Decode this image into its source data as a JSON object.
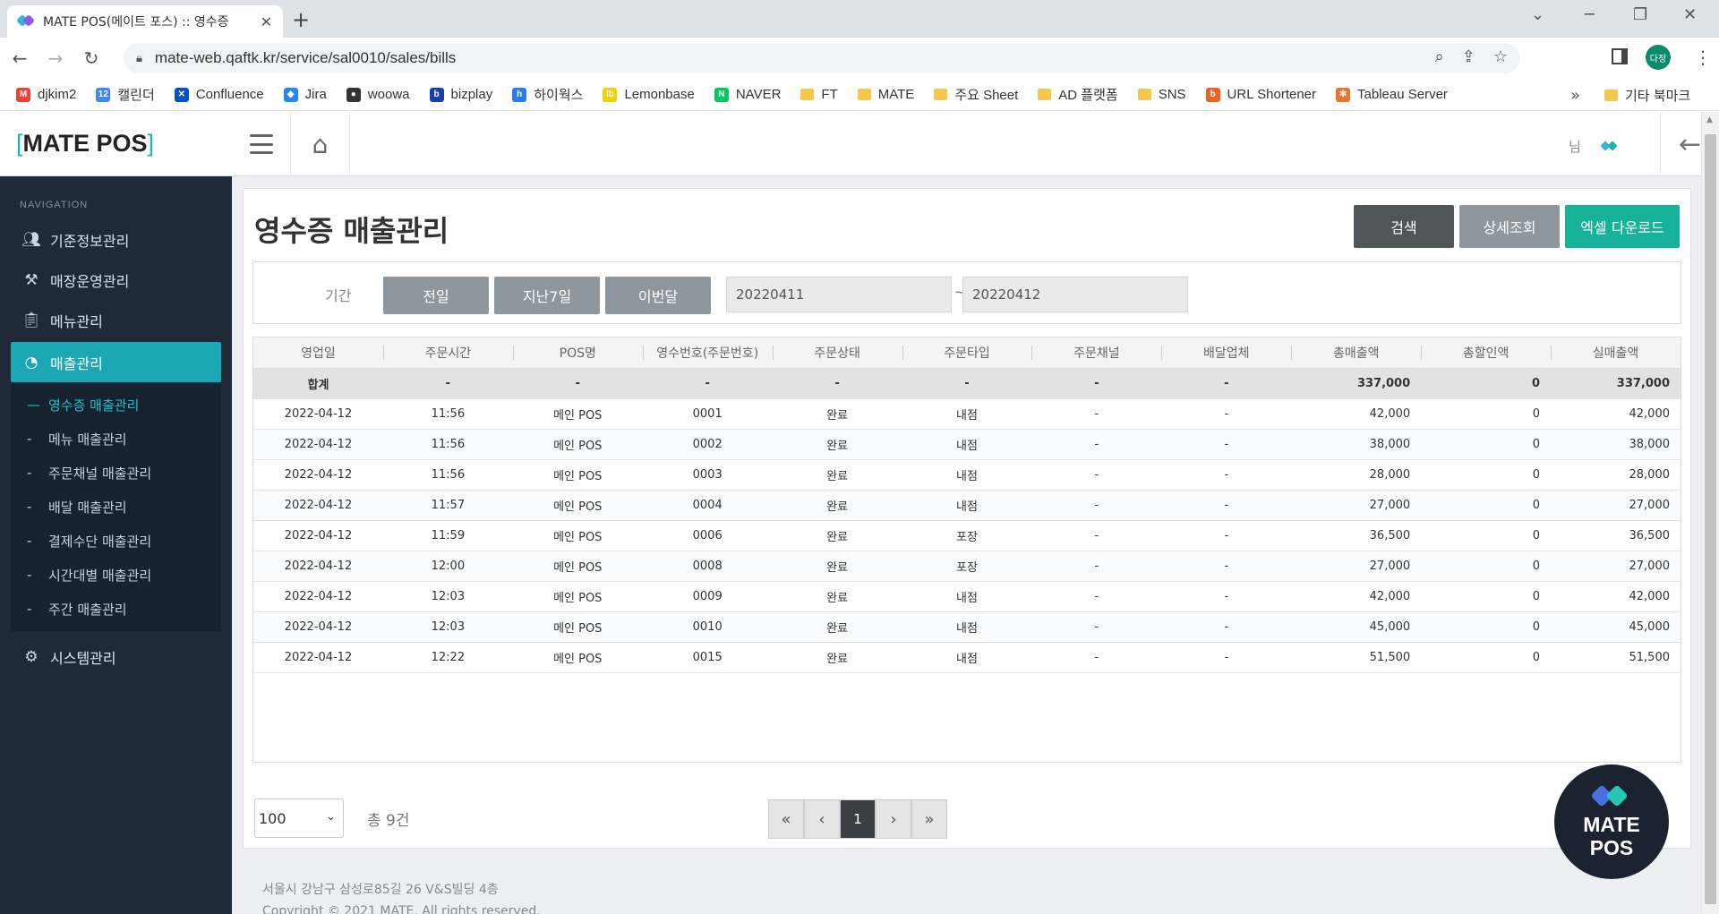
{
  "browser": {
    "tab_title": "MATE POS(메이트 포스) :: 영수증",
    "url": "mate-web.qaftk.kr/service/sal0010/sales/bills",
    "profile_initials": "다정",
    "bookmarks": [
      {
        "label": "djkim2",
        "color": "#ea4335",
        "glyph": "M"
      },
      {
        "label": "캘린더",
        "color": "#4285f4",
        "glyph": "12"
      },
      {
        "label": "Confluence",
        "color": "#0052cc",
        "glyph": "✕"
      },
      {
        "label": "Jira",
        "color": "#2684ff",
        "glyph": "◆"
      },
      {
        "label": "woowa",
        "color": "#333333",
        "glyph": "●"
      },
      {
        "label": "bizplay",
        "color": "#1a3fa8",
        "glyph": "b"
      },
      {
        "label": "하이웍스",
        "color": "#2b7de9",
        "glyph": "h"
      },
      {
        "label": "Lemonbase",
        "color": "#f5d000",
        "glyph": "lb"
      },
      {
        "label": "NAVER",
        "color": "#03c75a",
        "glyph": "N"
      },
      {
        "label": "FT",
        "color": "folder",
        "glyph": ""
      },
      {
        "label": "MATE",
        "color": "folder",
        "glyph": ""
      },
      {
        "label": "주요 Sheet",
        "color": "folder",
        "glyph": ""
      },
      {
        "label": "AD 플랫폼",
        "color": "folder",
        "glyph": ""
      },
      {
        "label": "SNS",
        "color": "folder",
        "glyph": ""
      },
      {
        "label": "URL Shortener",
        "color": "#ee6123",
        "glyph": "b"
      },
      {
        "label": "Tableau Server",
        "color": "#e8762d",
        "glyph": "✻"
      }
    ],
    "bookmark_more": "»",
    "other_bookmarks": "기타 북마크"
  },
  "app": {
    "brand_open": "[",
    "brand_name": "MATE POS",
    "brand_close": "]",
    "nav_caption": "NAVIGATION",
    "nav": [
      {
        "label": "기준정보관리",
        "icon": "users-icon"
      },
      {
        "label": "매장운영관리",
        "icon": "tools-icon"
      },
      {
        "label": "메뉴관리",
        "icon": "clipboard-icon"
      },
      {
        "label": "매출관리",
        "icon": "chart-pie-icon"
      },
      {
        "label": "시스템관리",
        "icon": "gear-icon"
      }
    ],
    "subnav": [
      {
        "label": "영수증 매출관리",
        "active": true
      },
      {
        "label": "메뉴 매출관리"
      },
      {
        "label": "주문채널 매출관리"
      },
      {
        "label": "배달 매출관리"
      },
      {
        "label": "결제수단 매출관리"
      },
      {
        "label": "시간대별 매출관리"
      },
      {
        "label": "주간 매출관리"
      }
    ],
    "user_suffix": "님",
    "accent": "#1ca7b4"
  },
  "page": {
    "title": "영수증 매출관리",
    "btn_search": "검색",
    "btn_detail": "상세조회",
    "btn_excel": "엑셀 다운로드",
    "filter_label": "기간",
    "quick": [
      "전일",
      "지난7일",
      "이번달"
    ],
    "date_from": "20220411",
    "date_tilde": "~",
    "date_to": "20220412"
  },
  "table": {
    "headers": [
      "영업일",
      "주문시간",
      "POS명",
      "영수번호(주문번호)",
      "주문상태",
      "주문타입",
      "주문채널",
      "배달업체",
      "총매출액",
      "총할인액",
      "실매출액"
    ],
    "total": [
      "합계",
      "-",
      "-",
      "-",
      "-",
      "-",
      "-",
      "-",
      "337,000",
      "0",
      "337,000"
    ],
    "rows": [
      [
        "2022-04-12",
        "11:56",
        "메인 POS",
        "0001",
        "완료",
        "내점",
        "-",
        "-",
        "42,000",
        "0",
        "42,000"
      ],
      [
        "2022-04-12",
        "11:56",
        "메인 POS",
        "0002",
        "완료",
        "내점",
        "-",
        "-",
        "38,000",
        "0",
        "38,000"
      ],
      [
        "2022-04-12",
        "11:56",
        "메인 POS",
        "0003",
        "완료",
        "내점",
        "-",
        "-",
        "28,000",
        "0",
        "28,000"
      ],
      [
        "2022-04-12",
        "11:57",
        "메인 POS",
        "0004",
        "완료",
        "내점",
        "-",
        "-",
        "27,000",
        "0",
        "27,000"
      ],
      [
        "2022-04-12",
        "11:59",
        "메인 POS",
        "0006",
        "완료",
        "포장",
        "-",
        "-",
        "36,500",
        "0",
        "36,500"
      ],
      [
        "2022-04-12",
        "12:00",
        "메인 POS",
        "0008",
        "완료",
        "포장",
        "-",
        "-",
        "27,000",
        "0",
        "27,000"
      ],
      [
        "2022-04-12",
        "12:03",
        "메인 POS",
        "0009",
        "완료",
        "내점",
        "-",
        "-",
        "42,000",
        "0",
        "42,000"
      ],
      [
        "2022-04-12",
        "12:03",
        "메인 POS",
        "0010",
        "완료",
        "내점",
        "-",
        "-",
        "45,000",
        "0",
        "45,000"
      ],
      [
        "2022-04-12",
        "12:22",
        "메인 POS",
        "0015",
        "완료",
        "내점",
        "-",
        "-",
        "51,500",
        "0",
        "51,500"
      ]
    ]
  },
  "pager": {
    "page_size": "100",
    "total_count": "총 9건",
    "first": "«",
    "prev": "‹",
    "current": "1",
    "next": "›",
    "last": "»"
  },
  "footer": {
    "address": "서울시 강남구 삼성로85길 26 V&S빌딩 4층",
    "copyright": "Copyright © 2021 MATE. All rights reserved."
  },
  "float_logo": {
    "line1": "MATE",
    "line2": "POS"
  }
}
